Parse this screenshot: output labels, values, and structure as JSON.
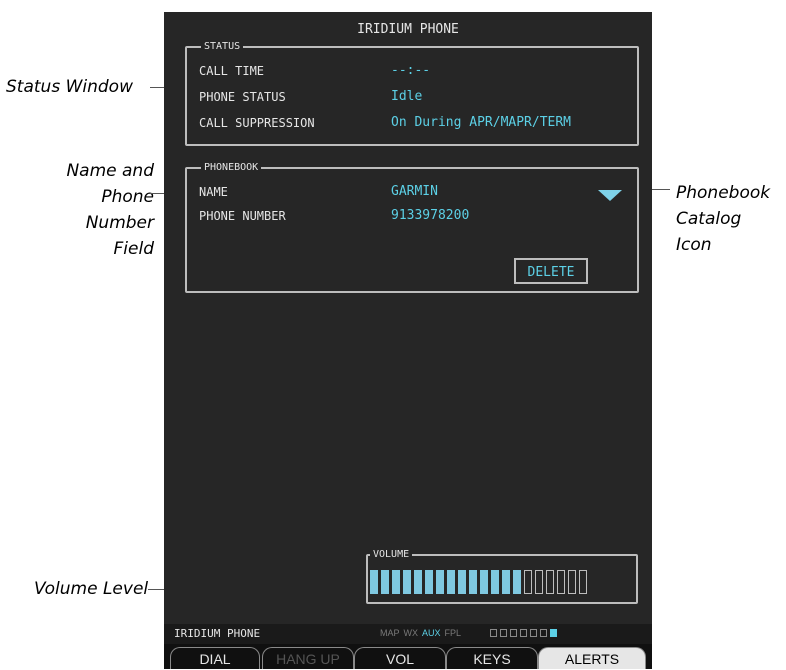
{
  "callouts": {
    "status_window": "Status Window",
    "name_phone": [
      "Name and",
      "Phone",
      "Number",
      "Field"
    ],
    "catalog_icon": [
      "Phonebook",
      "Catalog",
      "Icon"
    ],
    "volume_level": "Volume Level"
  },
  "page": {
    "title": "IRIDIUM PHONE"
  },
  "status": {
    "title": "STATUS",
    "call_time_label": "CALL TIME",
    "call_time_value": "--:--",
    "phone_status_label": "PHONE STATUS",
    "phone_status_value": "Idle",
    "call_suppression_label": "CALL SUPPRESSION",
    "call_suppression_value": "On During APR/MAPR/TERM"
  },
  "phonebook": {
    "title": "PHONEBOOK",
    "name_label": "NAME",
    "name_value": "GARMIN",
    "phone_label": "PHONE NUMBER",
    "phone_value": "9133978200",
    "delete_label": "DELETE",
    "catalog_icon": "triangle-down-icon"
  },
  "volume": {
    "title": "VOLUME",
    "level_filled": 14,
    "level_total": 20
  },
  "status_bar": {
    "page_name": "IRIDIUM PHONE",
    "groups": [
      "MAP",
      "WX",
      "AUX",
      "FPL"
    ],
    "active_group": "AUX",
    "page_dots_total": 7,
    "active_dot": 7
  },
  "softkeys": [
    {
      "label": "DIAL",
      "state": "normal"
    },
    {
      "label": "HANG UP",
      "state": "disabled"
    },
    {
      "label": "VOL",
      "state": "normal"
    },
    {
      "label": "KEYS",
      "state": "normal"
    },
    {
      "label": "ALERTS",
      "state": "active"
    }
  ],
  "colors": {
    "screen_bg": "#262626",
    "value_cyan": "#5cd0e6",
    "volume_fill": "#7fc8e0"
  }
}
